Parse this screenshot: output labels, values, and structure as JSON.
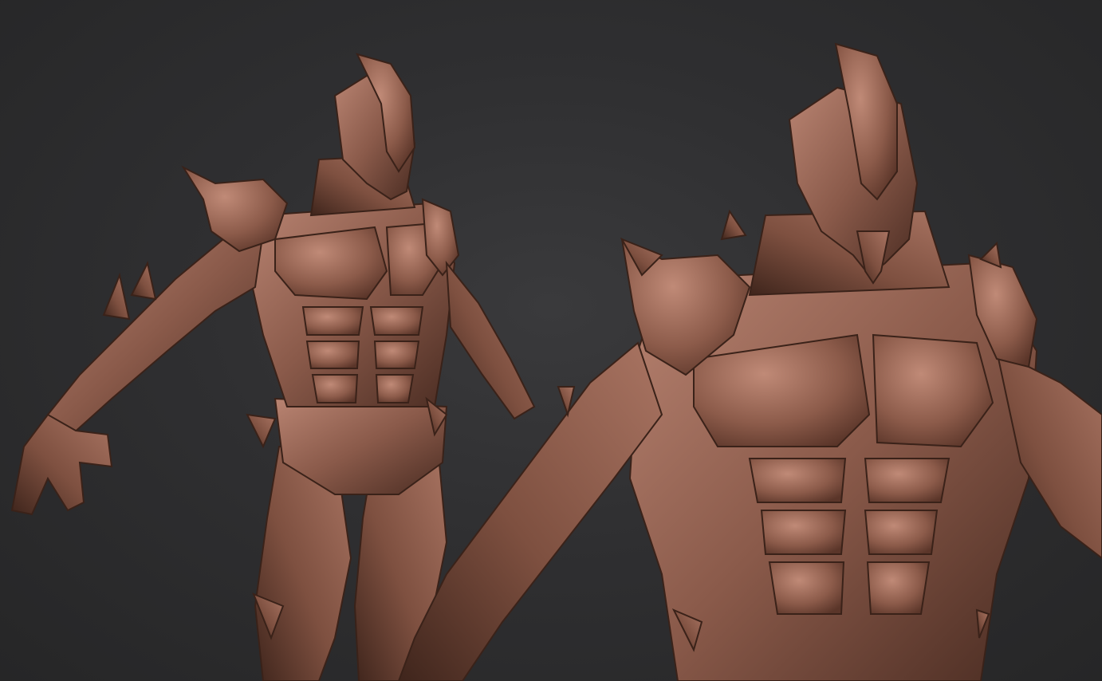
{
  "scene": {
    "background_color": "#2e2e30",
    "material_color": "#8a5a4a",
    "material_highlight": "#b98472",
    "material_shadow": "#4a2c22",
    "figures": [
      {
        "name": "full-body-view",
        "subject": "armored-creature-sculpt"
      },
      {
        "name": "torso-closeup-view",
        "subject": "armored-creature-sculpt"
      }
    ]
  }
}
